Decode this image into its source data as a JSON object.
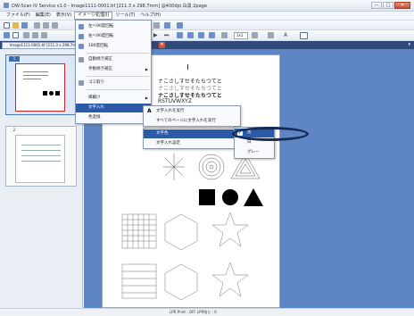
{
  "window": {
    "title": "DW-Scan IV Service v1.0 - Image1111-0001.tif [211.3 x 298.7mm] @400dpi 白黒 2page",
    "btn_min": "—",
    "btn_max": "□",
    "btn_close": "✕"
  },
  "menubar": {
    "items": [
      "ファイル(F)",
      "編集(E)",
      "表示(V)",
      "イメージ処理(I)",
      "ツール(T)",
      "ヘルプ(H)"
    ]
  },
  "toolbar": {
    "zoom_value": "1x1",
    "text_glyph": "A"
  },
  "tab": {
    "label": "Image1111-0001.tif [211.3 x 298.7mm]",
    "close": "✕"
  },
  "thumbnails": [
    {
      "num": "1",
      "selected": true
    },
    {
      "num": "2",
      "selected": false
    }
  ],
  "document": {
    "lines": [
      "ナこさしすせそたちつてと",
      "ナこさしすせそたちつてと",
      "ナこさしすせそたちつてと",
      "RSTUVWXYZ"
    ]
  },
  "image_menu": {
    "items": [
      {
        "label": "左へ90度回転"
      },
      {
        "label": "右へ90度回転"
      },
      {
        "label": "180度回転"
      },
      {
        "label": "自動傾き補正"
      },
      {
        "label": "手動傾き補正",
        "submenu": true
      },
      {
        "label": "ゴミ取り"
      },
      {
        "label": "掲載け",
        "submenu": true
      },
      {
        "label": "文字入れ",
        "submenu": true,
        "highlighted": true
      },
      {
        "label": "色変換",
        "submenu": true
      }
    ]
  },
  "text_menu": {
    "items": [
      {
        "label": "文字入れを実行"
      },
      {
        "label": "すべてのページに文字入れを実行"
      },
      {
        "label": "文字色",
        "highlighted": true
      },
      {
        "label": "文字入れ設定"
      }
    ]
  },
  "color_menu": {
    "items": [
      {
        "label": "黒",
        "checked": true,
        "highlighted": true
      },
      {
        "label": "白"
      },
      {
        "label": "グレー"
      }
    ],
    "check_glyph": "✔"
  },
  "statusbar": {
    "text": "LPR Print : OFF   LPR残り : 0"
  },
  "colors": {
    "menu_highlight": "#2a5aa8",
    "annotation_ring": "#152a55",
    "document_background": "#5f86c4"
  }
}
